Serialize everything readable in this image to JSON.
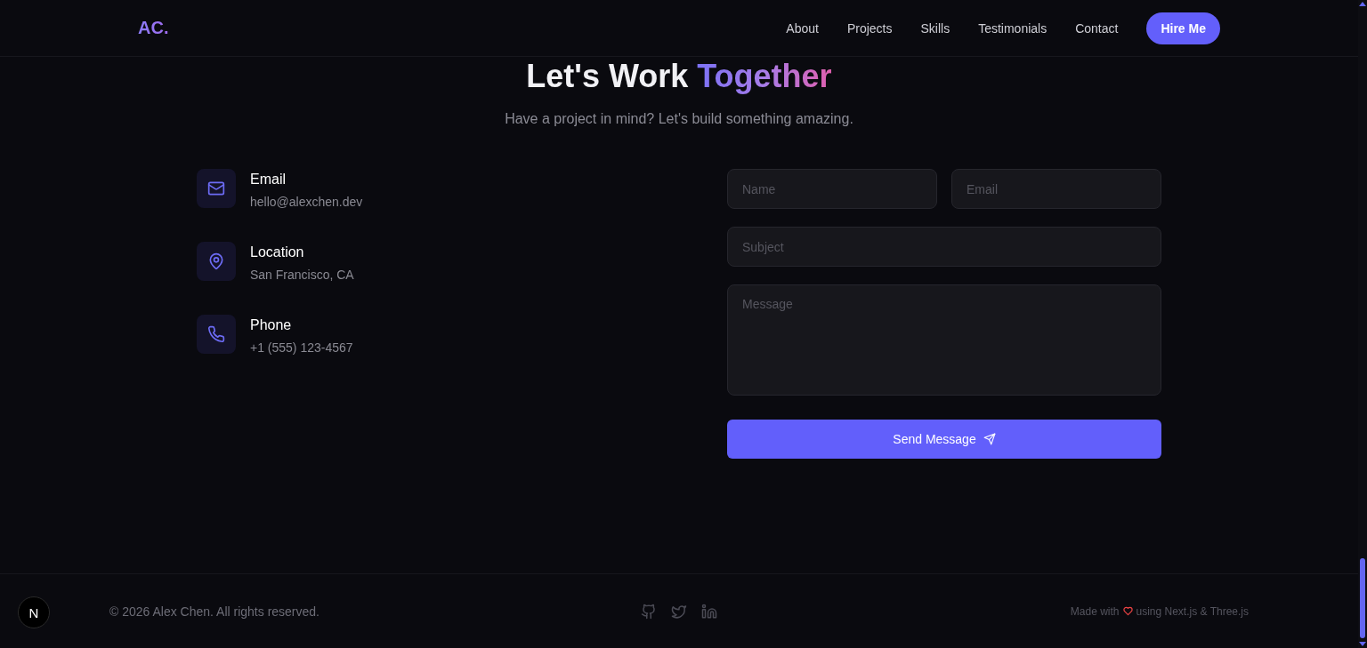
{
  "nav": {
    "logo": "AC.",
    "links": [
      {
        "label": "About"
      },
      {
        "label": "Projects"
      },
      {
        "label": "Skills"
      },
      {
        "label": "Testimonials"
      },
      {
        "label": "Contact"
      }
    ],
    "cta": "Hire Me"
  },
  "contact": {
    "heading": "Let's Work",
    "heading_highlight": "Together",
    "subtitle": "Have a project in mind? Let's build something amazing.",
    "info": [
      {
        "kind": "email",
        "label": "Email",
        "value": "hello@alexchen.dev"
      },
      {
        "kind": "location",
        "label": "Location",
        "value": "San Francisco, CA"
      },
      {
        "kind": "phone",
        "label": "Phone",
        "value": "+1 (555) 123-4567"
      }
    ],
    "form": {
      "fields": [
        {
          "kind": "input",
          "placeholder": "Name"
        },
        {
          "kind": "input",
          "placeholder": "Email"
        },
        {
          "kind": "input",
          "placeholder": "Subject"
        },
        {
          "kind": "textarea",
          "placeholder": "Message"
        }
      ],
      "submit": "Send Message"
    }
  },
  "footer": {
    "copyright": "© 2026 Alex Chen. All rights reserved.",
    "credit_before": "Made with",
    "credit_after": "using Next.js & Three.js"
  },
  "dev_badge": {
    "label": "N"
  }
}
